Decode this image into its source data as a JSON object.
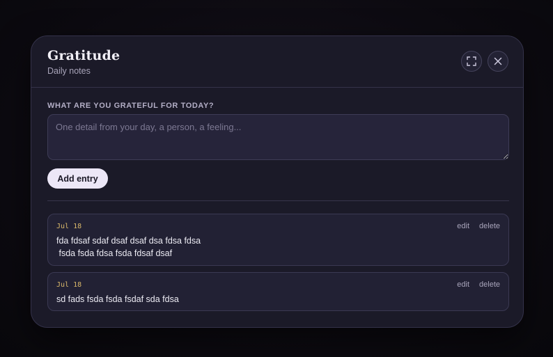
{
  "modal": {
    "title": "Gratitude",
    "subtitle": "Daily notes"
  },
  "composer": {
    "label": "WHAT ARE YOU GRATEFUL FOR TODAY?",
    "placeholder": "One detail from your day, a person, a feeling...",
    "value": "",
    "add_button_label": "Add entry"
  },
  "entries": [
    {
      "date": "Jul 18",
      "text": "fda fdsaf sdaf dsaf dsaf dsa fdsa fdsa\n fsda fsda fdsa fsda fdsaf dsaf",
      "edit_label": "edit",
      "delete_label": "delete"
    },
    {
      "date": "Jul 18",
      "text": "sd fads fsda fsda fsdaf sda fdsa",
      "edit_label": "edit",
      "delete_label": "delete"
    }
  ],
  "icons": {
    "expand": "expand-icon",
    "close": "close-icon"
  },
  "colors": {
    "accent_date": "#d9b86a",
    "button_bg": "#ece7f7",
    "modal_bg": "#1b1a28"
  }
}
